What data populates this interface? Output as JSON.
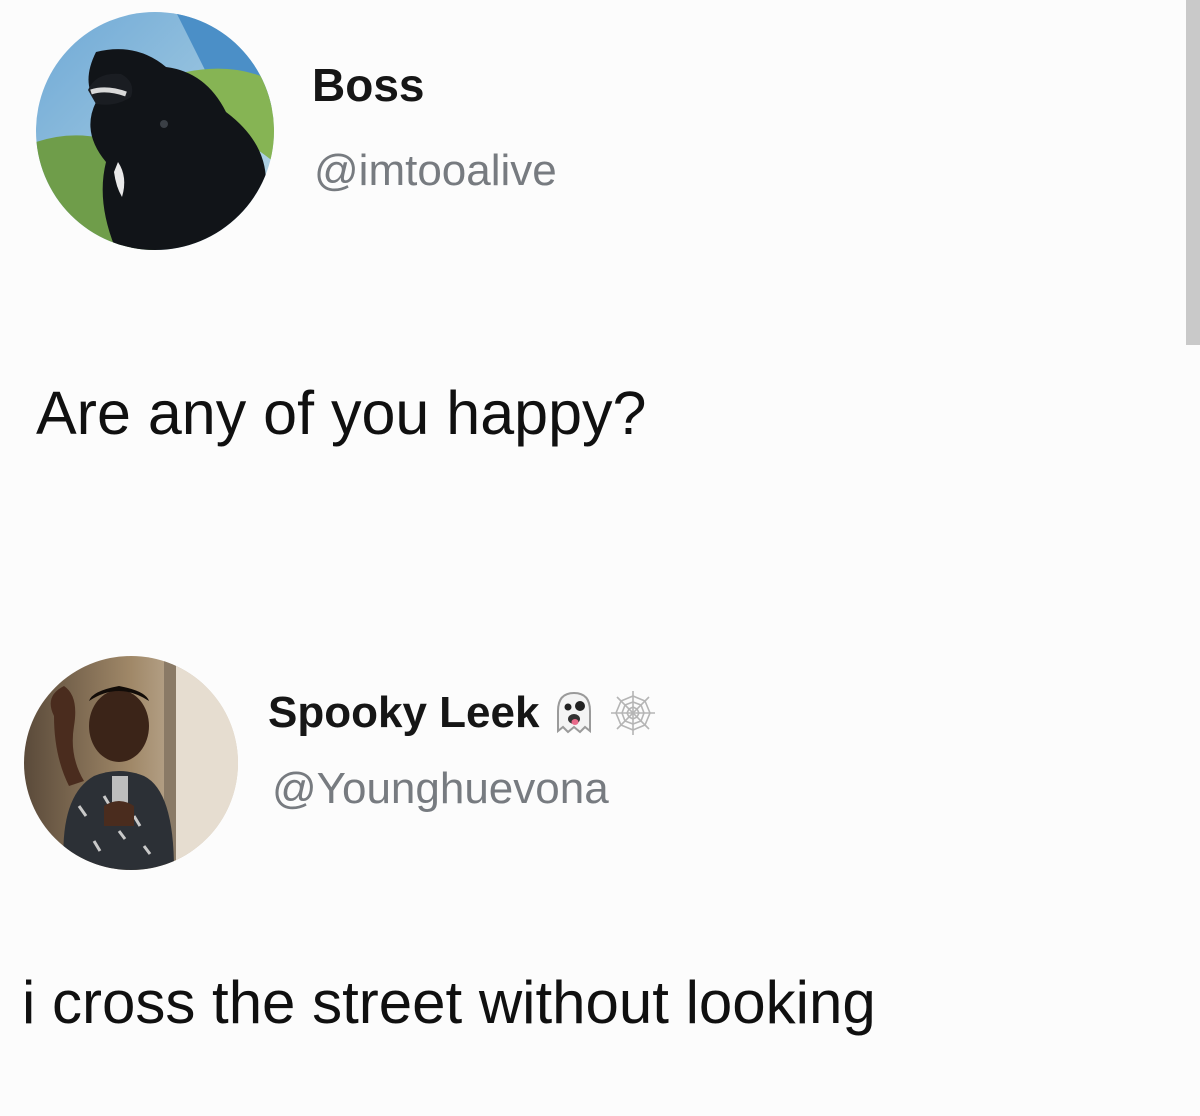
{
  "tweets": [
    {
      "display_name": "Boss",
      "handle": "@imtooalive",
      "text": "Are any of you happy?",
      "avatar": "dog-photo-avatar"
    },
    {
      "display_name": "Spooky Leek",
      "name_emojis": [
        "ghost-emoji",
        "spider-web-emoji"
      ],
      "handle": "@Younghuevona",
      "text": "i cross the street without looking",
      "avatar": "person-selfie-avatar"
    }
  ]
}
